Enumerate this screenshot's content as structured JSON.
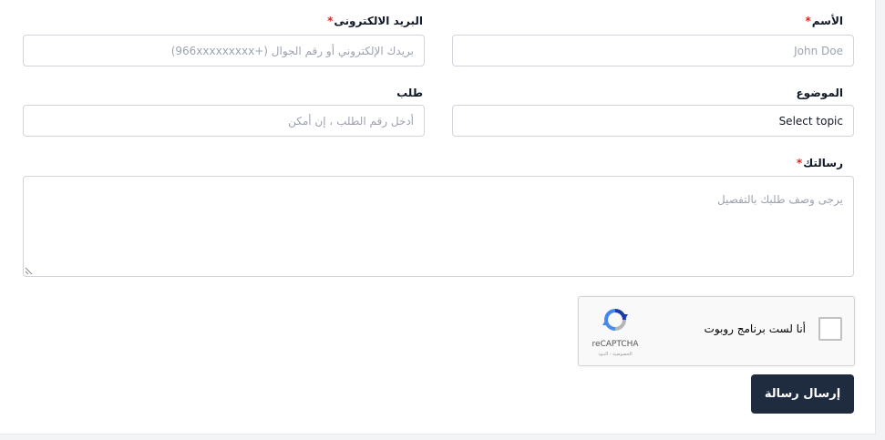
{
  "form": {
    "name": {
      "label": "الأسم",
      "required_mark": "*",
      "placeholder": "John Doe"
    },
    "email": {
      "label": "البريد الالكترونى",
      "required_mark": "*",
      "placeholder": "بريدك الإلكتروني أو رقم الجوال (+966xxxxxxxxx)"
    },
    "subject": {
      "label": "الموضوع",
      "value": "Select topic"
    },
    "order": {
      "label": "طلب",
      "placeholder": "أدخل رقم الطلب ، إن أمكن"
    },
    "message": {
      "label": "رسالتك",
      "required_mark": "*",
      "placeholder": "يرجى وصف طلبك بالتفصيل"
    },
    "captcha": {
      "text": "أنا لست برنامج روبوت",
      "brand": "reCAPTCHA",
      "links": "الخصوصية - البنود",
      "logo_icon": "recaptcha-logo-icon"
    },
    "submit_label": "إرسال رسالة"
  },
  "colors": {
    "required": "#dc2626",
    "button": "#1f2b3e",
    "border": "#d1d5db"
  }
}
